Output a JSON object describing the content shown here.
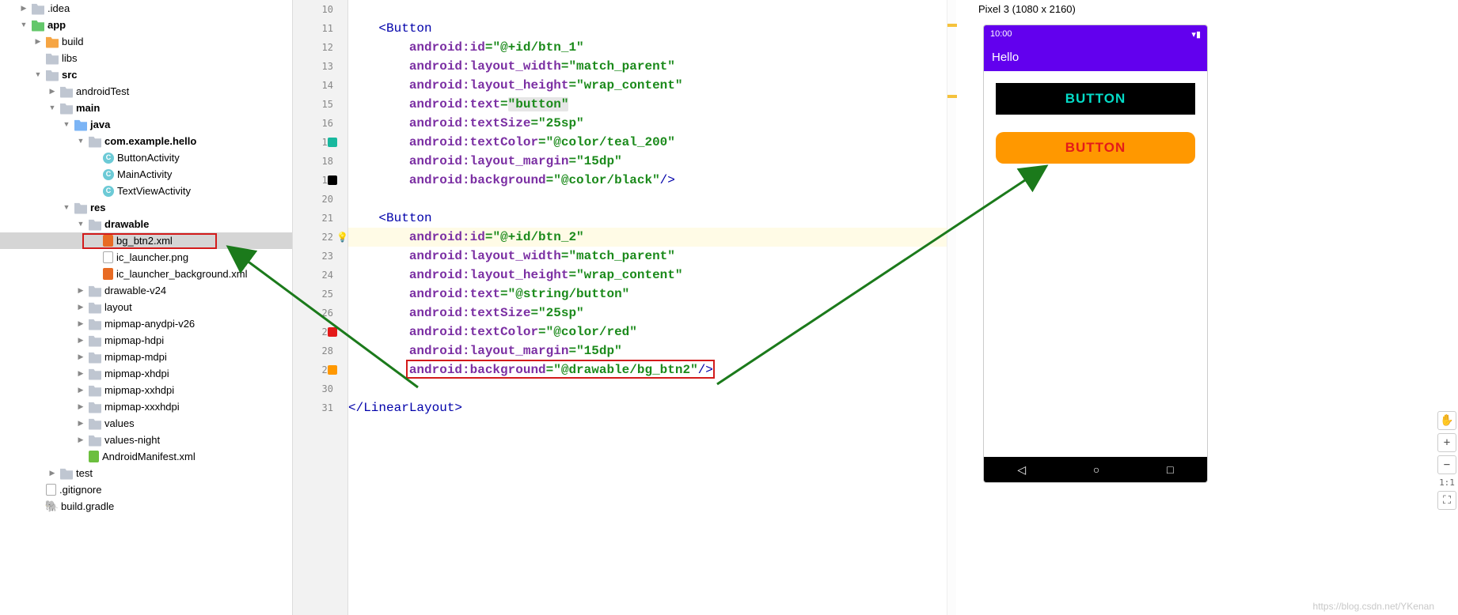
{
  "tree": {
    "items": [
      {
        "indent": 1,
        "arrow": "right",
        "icon": "folder-gray",
        "label": ".idea",
        "bold": false
      },
      {
        "indent": 1,
        "arrow": "down",
        "icon": "folder-green",
        "label": "app",
        "bold": true
      },
      {
        "indent": 2,
        "arrow": "right",
        "icon": "folder-orange",
        "label": "build",
        "bold": false
      },
      {
        "indent": 2,
        "arrow": "blank",
        "icon": "folder-gray",
        "label": "libs",
        "bold": false
      },
      {
        "indent": 2,
        "arrow": "down",
        "icon": "folder-gray",
        "label": "src",
        "bold": true
      },
      {
        "indent": 3,
        "arrow": "right",
        "icon": "folder-gray",
        "label": "androidTest",
        "bold": false
      },
      {
        "indent": 3,
        "arrow": "down",
        "icon": "folder-gray",
        "label": "main",
        "bold": true
      },
      {
        "indent": 4,
        "arrow": "down",
        "icon": "folder-blue",
        "label": "java",
        "bold": true
      },
      {
        "indent": 5,
        "arrow": "down",
        "icon": "folder-gray",
        "label": "com.example.hello",
        "bold": true
      },
      {
        "indent": 6,
        "arrow": "blank",
        "icon": "class",
        "label": "ButtonActivity",
        "bold": false
      },
      {
        "indent": 6,
        "arrow": "blank",
        "icon": "class",
        "label": "MainActivity",
        "bold": false
      },
      {
        "indent": 6,
        "arrow": "blank",
        "icon": "class",
        "label": "TextViewActivity",
        "bold": false
      },
      {
        "indent": 4,
        "arrow": "down",
        "icon": "folder-gray",
        "label": "res",
        "bold": true
      },
      {
        "indent": 5,
        "arrow": "down",
        "icon": "folder-gray",
        "label": "drawable",
        "bold": true
      },
      {
        "indent": 6,
        "arrow": "blank",
        "icon": "xml",
        "label": "bg_btn2.xml",
        "bold": false,
        "selected": true,
        "redbox": true
      },
      {
        "indent": 6,
        "arrow": "blank",
        "icon": "file",
        "label": "ic_launcher.png",
        "bold": false
      },
      {
        "indent": 6,
        "arrow": "blank",
        "icon": "xml",
        "label": "ic_launcher_background.xml",
        "bold": false
      },
      {
        "indent": 5,
        "arrow": "right",
        "icon": "folder-gray",
        "label": "drawable-v24",
        "bold": false
      },
      {
        "indent": 5,
        "arrow": "right",
        "icon": "folder-gray",
        "label": "layout",
        "bold": false
      },
      {
        "indent": 5,
        "arrow": "right",
        "icon": "folder-gray",
        "label": "mipmap-anydpi-v26",
        "bold": false
      },
      {
        "indent": 5,
        "arrow": "right",
        "icon": "folder-gray",
        "label": "mipmap-hdpi",
        "bold": false
      },
      {
        "indent": 5,
        "arrow": "right",
        "icon": "folder-gray",
        "label": "mipmap-mdpi",
        "bold": false
      },
      {
        "indent": 5,
        "arrow": "right",
        "icon": "folder-gray",
        "label": "mipmap-xhdpi",
        "bold": false
      },
      {
        "indent": 5,
        "arrow": "right",
        "icon": "folder-gray",
        "label": "mipmap-xxhdpi",
        "bold": false
      },
      {
        "indent": 5,
        "arrow": "right",
        "icon": "folder-gray",
        "label": "mipmap-xxxhdpi",
        "bold": false
      },
      {
        "indent": 5,
        "arrow": "right",
        "icon": "folder-gray",
        "label": "values",
        "bold": false
      },
      {
        "indent": 5,
        "arrow": "right",
        "icon": "folder-gray",
        "label": "values-night",
        "bold": false
      },
      {
        "indent": 5,
        "arrow": "blank",
        "icon": "mf",
        "label": "AndroidManifest.xml",
        "bold": false
      },
      {
        "indent": 3,
        "arrow": "right",
        "icon": "folder-gray",
        "label": "test",
        "bold": false
      },
      {
        "indent": 2,
        "arrow": "blank",
        "icon": "file",
        "label": ".gitignore",
        "bold": false
      },
      {
        "indent": 2,
        "arrow": "blank",
        "icon": "elephant",
        "label": "build.gradle",
        "bold": false
      }
    ]
  },
  "gutter": {
    "start": 10,
    "lines": [
      {
        "n": "10"
      },
      {
        "n": "11"
      },
      {
        "n": "12"
      },
      {
        "n": "13"
      },
      {
        "n": "14"
      },
      {
        "n": "15"
      },
      {
        "n": "16"
      },
      {
        "n": "17",
        "dot": "#18b89e"
      },
      {
        "n": "18"
      },
      {
        "n": "19",
        "dot": "#000"
      },
      {
        "n": "20"
      },
      {
        "n": "21"
      },
      {
        "n": "22",
        "glyph": "💡",
        "current": true
      },
      {
        "n": "23"
      },
      {
        "n": "24"
      },
      {
        "n": "25"
      },
      {
        "n": "26"
      },
      {
        "n": "27",
        "dot": "#e41a1a"
      },
      {
        "n": "28"
      },
      {
        "n": "29",
        "dot": "#ff9800"
      },
      {
        "n": "30"
      },
      {
        "n": "31"
      }
    ]
  },
  "code": {
    "lines": [
      {
        "ind": 1,
        "text": ""
      },
      {
        "ind": 1,
        "tag_open": "<Button"
      },
      {
        "ind": 2,
        "attr": "android:id",
        "eq": "=",
        "val": "\"@+id/btn_1\""
      },
      {
        "ind": 2,
        "attr": "android:layout_width",
        "eq": "=",
        "val": "\"match_parent\""
      },
      {
        "ind": 2,
        "attr": "android:layout_height",
        "eq": "=",
        "val": "\"wrap_content\""
      },
      {
        "ind": 2,
        "attr": "android:text",
        "eq": "=",
        "val_box": "\"button\""
      },
      {
        "ind": 2,
        "attr": "android:textSize",
        "eq": "=",
        "val": "\"25sp\""
      },
      {
        "ind": 2,
        "attr": "android:textColor",
        "eq": "=",
        "val": "\"@color/teal_200\""
      },
      {
        "ind": 2,
        "attr": "android:layout_margin",
        "eq": "=",
        "val": "\"15dp\""
      },
      {
        "ind": 2,
        "attr": "android:background",
        "eq": "=",
        "val": "\"@color/black\"",
        "end": "/>"
      },
      {
        "ind": 1,
        "text": ""
      },
      {
        "ind": 1,
        "tag_open": "<Button"
      },
      {
        "ind": 2,
        "attr": "android:id",
        "eq": "=",
        "val": "\"@+id/btn_2\"",
        "current": true
      },
      {
        "ind": 2,
        "attr": "android:layout_width",
        "eq": "=",
        "val": "\"match_parent\""
      },
      {
        "ind": 2,
        "attr": "android:layout_height",
        "eq": "=",
        "val": "\"wrap_content\""
      },
      {
        "ind": 2,
        "attr": "android:text",
        "eq": "=",
        "val": "\"@string/button\""
      },
      {
        "ind": 2,
        "attr": "android:textSize",
        "eq": "=",
        "val": "\"25sp\""
      },
      {
        "ind": 2,
        "attr": "android:textColor",
        "eq": "=",
        "val": "\"@color/red\""
      },
      {
        "ind": 2,
        "attr": "android:layout_margin",
        "eq": "=",
        "val": "\"15dp\""
      },
      {
        "ind": 2,
        "attr": "android:background",
        "eq": "=",
        "val": "\"@drawable/bg_btn2\"",
        "end": "/>",
        "redbox": true
      },
      {
        "ind": 1,
        "text": ""
      },
      {
        "ind": 0,
        "tag_close": "</LinearLayout>"
      }
    ]
  },
  "preview": {
    "caption": "Pixel 3 (1080 x 2160)",
    "clock": "10:00",
    "appbar": "Hello",
    "btn1": "BUTTON",
    "btn2": "BUTTON",
    "nav": {
      "back": "◁",
      "home": "○",
      "recent": "□"
    }
  },
  "toolcol": {
    "pan": "✋",
    "plus": "+",
    "minus": "−",
    "ratio": "1:1",
    "fit": "⛶"
  },
  "watermark": "https://blog.csdn.net/YKenan"
}
